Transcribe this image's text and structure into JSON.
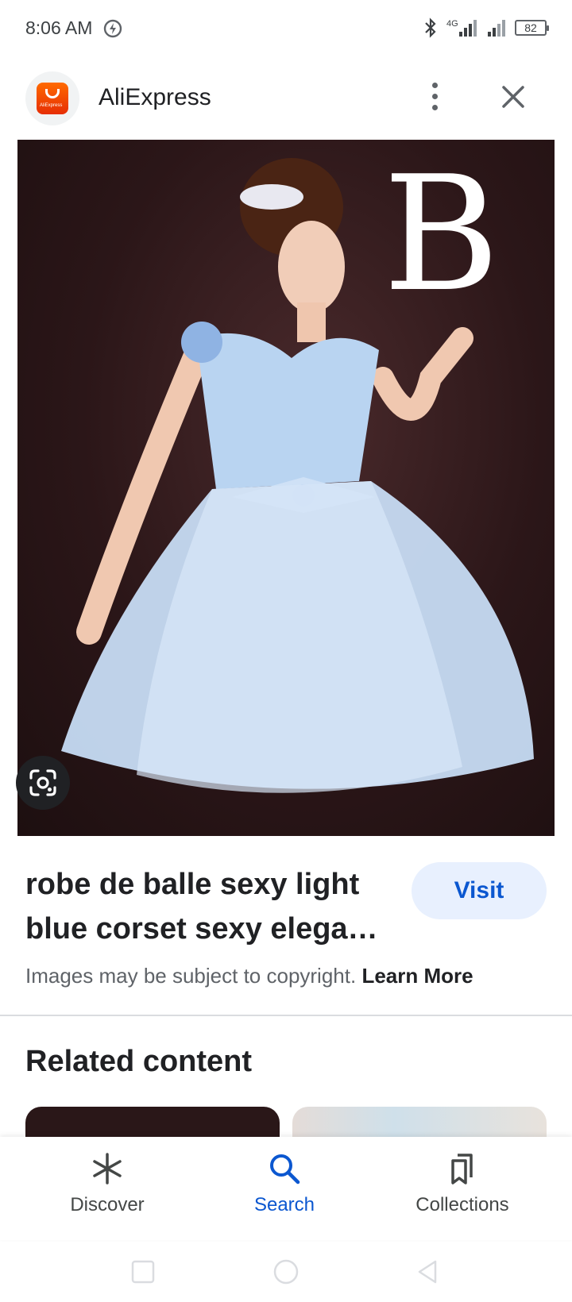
{
  "status_bar": {
    "time": "8:06 AM",
    "network": "4G",
    "battery": "82"
  },
  "header": {
    "app_name": "AliExpress",
    "logo_text": "AliExpress",
    "logo_color": "#e62e04"
  },
  "image": {
    "overlay_letter": "B",
    "background_color": "#2b1618",
    "dress_color": "#b9d4f1"
  },
  "result": {
    "title": "robe de balle sexy light blue corset sexy elega…",
    "visit_label": "Visit",
    "copyright_text": "Images may be subject to copyright.",
    "learn_more_label": "Learn More"
  },
  "related": {
    "heading": "Related content"
  },
  "bottom_nav": {
    "items": [
      {
        "label": "Discover",
        "icon": "asterisk-icon",
        "active": false
      },
      {
        "label": "Search",
        "icon": "search-icon",
        "active": true
      },
      {
        "label": "Collections",
        "icon": "collections-icon",
        "active": false
      }
    ]
  },
  "colors": {
    "accent": "#0b57d0",
    "visit_bg": "#e8f0fe"
  }
}
